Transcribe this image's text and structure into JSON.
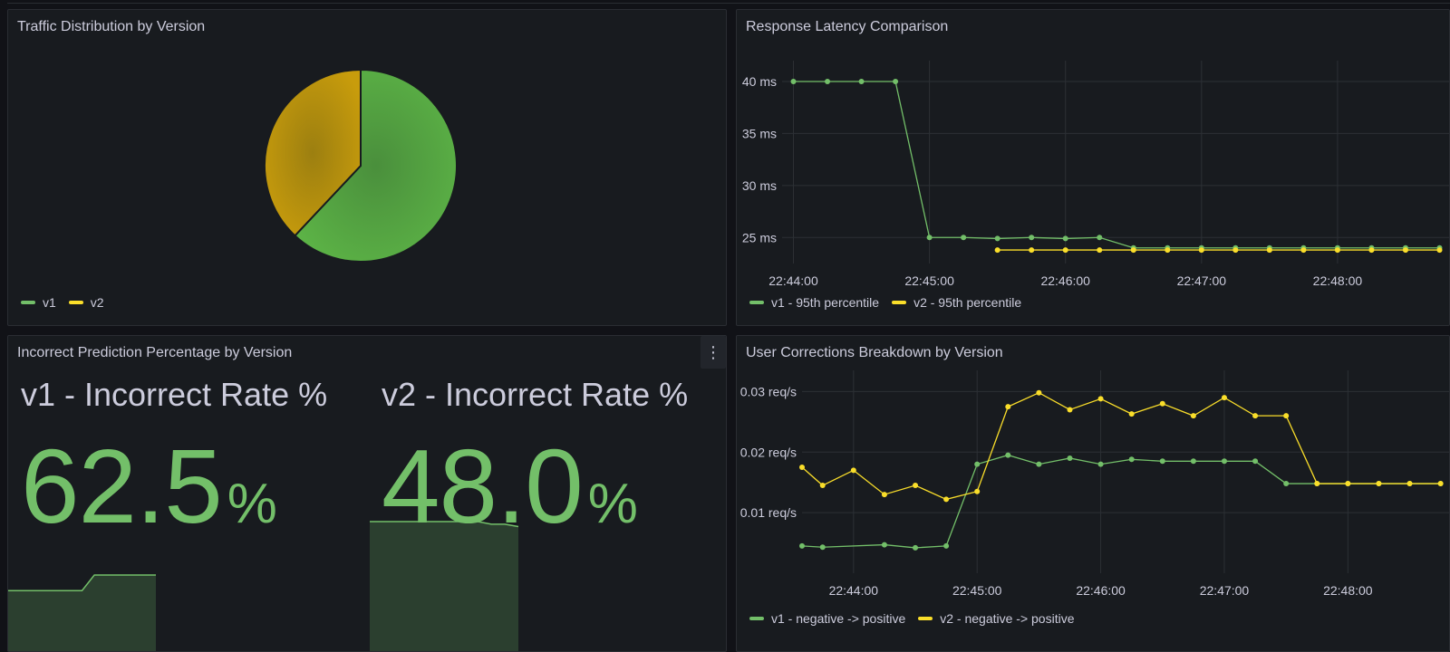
{
  "colors": {
    "v1": "#73bf69",
    "v2": "#fade2a",
    "pie_v2": "#c49a0c",
    "grid": "#2c3035",
    "axis_text": "#ccccdc"
  },
  "panels": {
    "traffic": {
      "title": "Traffic Distribution by Version",
      "legend": [
        "v1",
        "v2"
      ]
    },
    "latency": {
      "title": "Response Latency Comparison",
      "legend": [
        "v1 - 95th percentile",
        "v2 - 95th percentile"
      ]
    },
    "incorrect": {
      "title": "Incorrect Prediction Percentage by Version",
      "menu_icon": "more-vertical-icon",
      "stats": [
        {
          "label": "v1 - Incorrect Rate %",
          "value": "62.5",
          "unit": "%"
        },
        {
          "label": "v2 - Incorrect Rate %",
          "value": "48.0",
          "unit": "%"
        }
      ]
    },
    "corrections": {
      "title": "User Corrections Breakdown by Version",
      "legend": [
        "v1 - negative -> positive",
        "v2 - negative -> positive"
      ]
    }
  },
  "chart_data": [
    {
      "id": "traffic",
      "type": "pie",
      "title": "Traffic Distribution by Version",
      "labels": [
        "v1",
        "v2"
      ],
      "values": [
        62,
        38
      ],
      "legend": "bottom-left"
    },
    {
      "id": "latency",
      "type": "line",
      "title": "Response Latency Comparison",
      "ylabel_unit": "ms",
      "ylim": [
        22.5,
        42
      ],
      "yticks": [
        25,
        30,
        35,
        40
      ],
      "ytick_labels": [
        "25 ms",
        "30 ms",
        "35 ms",
        "40 ms"
      ],
      "xlim": [
        "22:43:55",
        "22:48:50"
      ],
      "xticks": [
        "22:44:00",
        "22:45:00",
        "22:46:00",
        "22:47:00",
        "22:48:00"
      ],
      "grid": true,
      "legend": "bottom-left",
      "series": [
        {
          "name": "v1 - 95th percentile",
          "x": [
            "22:44:00",
            "22:44:15",
            "22:44:30",
            "22:44:45",
            "22:45:00",
            "22:45:15",
            "22:45:30",
            "22:45:45",
            "22:46:00",
            "22:46:15",
            "22:46:30",
            "22:46:45",
            "22:47:00",
            "22:47:15",
            "22:47:30",
            "22:47:45",
            "22:48:00",
            "22:48:15",
            "22:48:30",
            "22:48:45"
          ],
          "y": [
            40,
            40,
            40,
            40,
            25,
            25,
            24.9,
            25,
            24.9,
            25,
            24,
            24,
            24,
            24,
            24,
            24,
            24,
            24,
            24,
            24
          ]
        },
        {
          "name": "v2 - 95th percentile",
          "x": [
            "22:45:30",
            "22:45:45",
            "22:46:00",
            "22:46:15",
            "22:46:30",
            "22:46:45",
            "22:47:00",
            "22:47:15",
            "22:47:30",
            "22:47:45",
            "22:48:00",
            "22:48:15",
            "22:48:30",
            "22:48:45"
          ],
          "y": [
            23.8,
            23.8,
            23.8,
            23.8,
            23.8,
            23.8,
            23.8,
            23.8,
            23.8,
            23.8,
            23.8,
            23.8,
            23.8,
            23.8
          ]
        }
      ]
    },
    {
      "id": "v1_sparkline",
      "type": "area",
      "series": [
        {
          "y": [
            58,
            58,
            58,
            58,
            58,
            58,
            58,
            62.5,
            62.5,
            62.5,
            62.5,
            62.5,
            62.5
          ]
        }
      ]
    },
    {
      "id": "v2_sparkline",
      "type": "area",
      "series": [
        {
          "y": [
            50.5,
            50.5,
            50.5,
            50.5,
            50.5,
            50.5,
            50.5,
            50.5,
            50.5,
            49.5,
            49.5,
            48.6
          ]
        }
      ]
    },
    {
      "id": "corrections",
      "type": "line",
      "title": "User Corrections Breakdown by Version",
      "ylim": [
        0,
        0.0335
      ],
      "yticks": [
        0.01,
        0.02,
        0.03
      ],
      "ytick_labels": [
        "0.01 req/s",
        "0.02 req/s",
        "0.03 req/s"
      ],
      "xlim": [
        "22:43:35",
        "22:48:50"
      ],
      "xticks": [
        "22:44:00",
        "22:45:00",
        "22:46:00",
        "22:47:00",
        "22:48:00"
      ],
      "grid": true,
      "legend": "bottom-left",
      "series": [
        {
          "name": "v1 - negative -> positive",
          "x": [
            "22:43:35",
            "22:43:45",
            "22:44:15",
            "22:44:30",
            "22:44:45",
            "22:45:00",
            "22:45:15",
            "22:45:30",
            "22:45:45",
            "22:46:00",
            "22:46:15",
            "22:46:30",
            "22:46:45",
            "22:47:00",
            "22:47:15",
            "22:47:30",
            "22:47:45",
            "22:48:00",
            "22:48:15",
            "22:48:30",
            "22:48:45"
          ],
          "y": [
            0.0045,
            0.0043,
            0.0047,
            0.0042,
            0.0045,
            0.018,
            0.0195,
            0.018,
            0.019,
            0.018,
            0.0188,
            0.0185,
            0.0185,
            0.0185,
            0.0185,
            0.0148,
            0.0148,
            0.0148,
            0.0148,
            0.0148,
            0.0148
          ]
        },
        {
          "name": "v2 - negative -> positive",
          "x": [
            "22:43:35",
            "22:43:45",
            "22:44:00",
            "22:44:15",
            "22:44:30",
            "22:44:45",
            "22:45:00",
            "22:45:15",
            "22:45:30",
            "22:45:45",
            "22:46:00",
            "22:46:15",
            "22:46:30",
            "22:46:45",
            "22:47:00",
            "22:47:15",
            "22:47:30",
            "22:47:45",
            "22:48:00",
            "22:48:15",
            "22:48:30",
            "22:48:45"
          ],
          "y": [
            0.0175,
            0.0145,
            0.017,
            0.013,
            0.0145,
            0.0122,
            0.0135,
            0.0275,
            0.0298,
            0.027,
            0.0288,
            0.0263,
            0.028,
            0.026,
            0.029,
            0.026,
            0.026,
            0.0148,
            0.0148,
            0.0148,
            0.0148,
            0.0148
          ]
        }
      ]
    }
  ]
}
